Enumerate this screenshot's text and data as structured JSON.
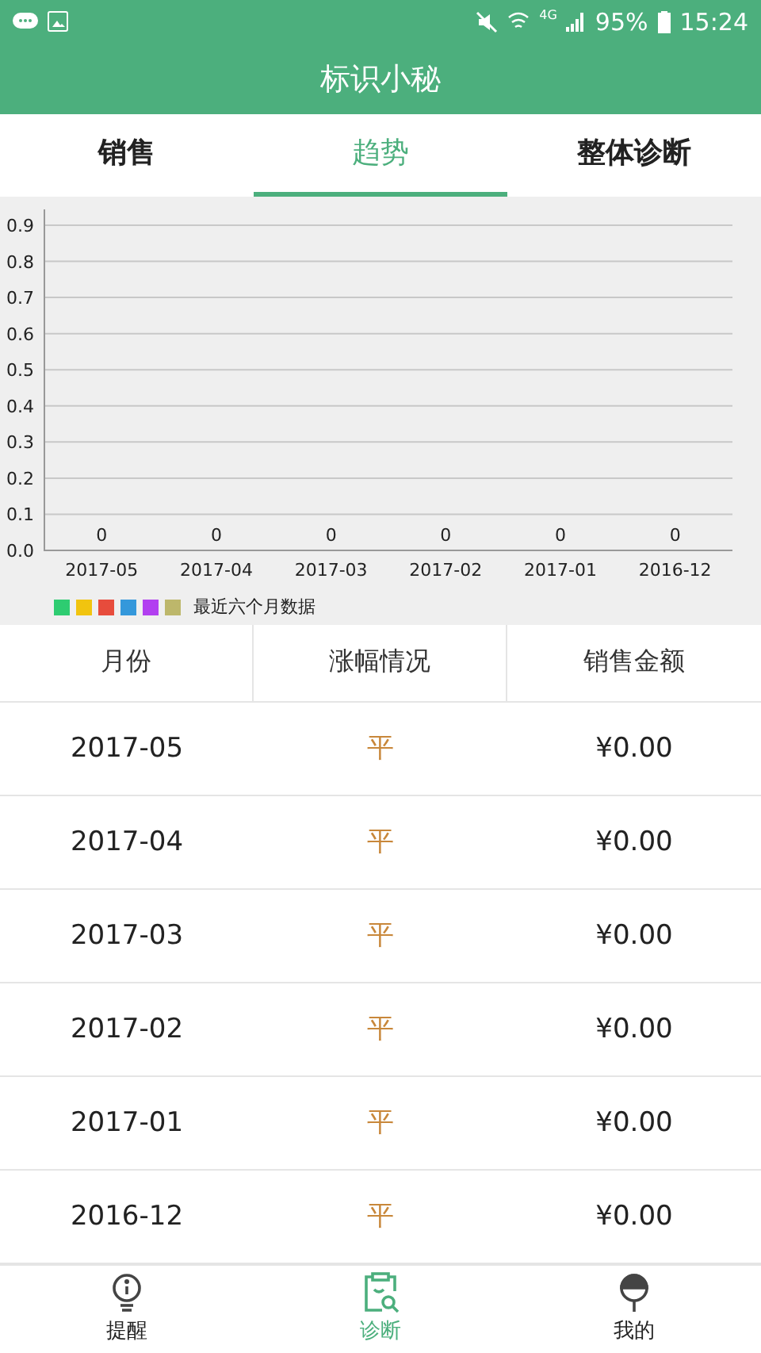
{
  "status_bar": {
    "battery": "95%",
    "network": "4G",
    "time": "15:24"
  },
  "title": "标识小秘",
  "tabs": [
    {
      "label": "销售",
      "selected": false
    },
    {
      "label": "趋势",
      "selected": true
    },
    {
      "label": "整体诊断",
      "selected": false
    }
  ],
  "chart": {
    "chart_data": {
      "type": "bar",
      "categories": [
        "2017-05",
        "2017-04",
        "2017-03",
        "2017-02",
        "2017-01",
        "2016-12"
      ],
      "series": [
        {
          "name": "最近六个月数据",
          "values": [
            0,
            0,
            0,
            0,
            0,
            0
          ]
        }
      ],
      "grid": true,
      "ylim": [
        0,
        0.9
      ],
      "yticks": [
        {
          "value": 0,
          "label": "0.0"
        },
        {
          "value": 0.1,
          "label": "0.1"
        },
        {
          "value": 0.2,
          "label": "0.2"
        },
        {
          "value": 0.3,
          "label": "0.3"
        },
        {
          "value": 0.4,
          "label": "0.4"
        },
        {
          "value": 0.5,
          "label": "0.5"
        },
        {
          "value": 0.6,
          "label": "0.6"
        },
        {
          "value": 0.7,
          "label": "0.7"
        },
        {
          "value": 0.8,
          "label": "0.8"
        },
        {
          "value": 0.9,
          "label": "0.9"
        }
      ],
      "data_labels": true
    },
    "legend": {
      "swatches": [
        {
          "color": "#2ecc71"
        },
        {
          "color": "#f1c40f"
        },
        {
          "color": "#e74c3c"
        },
        {
          "color": "#3498db"
        },
        {
          "color": "#b23ff0"
        },
        {
          "color": "#bdb76b"
        }
      ]
    }
  },
  "table": {
    "columns": [
      "月份",
      "涨幅情况",
      "销售金额"
    ],
    "rows": [
      {
        "month": "2017-05",
        "change": "平",
        "amount": "¥0.00"
      },
      {
        "month": "2017-04",
        "change": "平",
        "amount": "¥0.00"
      },
      {
        "month": "2017-03",
        "change": "平",
        "amount": "¥0.00"
      },
      {
        "month": "2017-02",
        "change": "平",
        "amount": "¥0.00"
      },
      {
        "month": "2017-01",
        "change": "平",
        "amount": "¥0.00"
      },
      {
        "month": "2016-12",
        "change": "平",
        "amount": "¥0.00"
      }
    ]
  },
  "bottom_nav": [
    {
      "label": "提醒",
      "kind": "bulb",
      "selected": false
    },
    {
      "label": "诊断",
      "kind": "clipboard",
      "selected": true
    },
    {
      "label": "我的",
      "kind": "lamp",
      "selected": false
    }
  ]
}
